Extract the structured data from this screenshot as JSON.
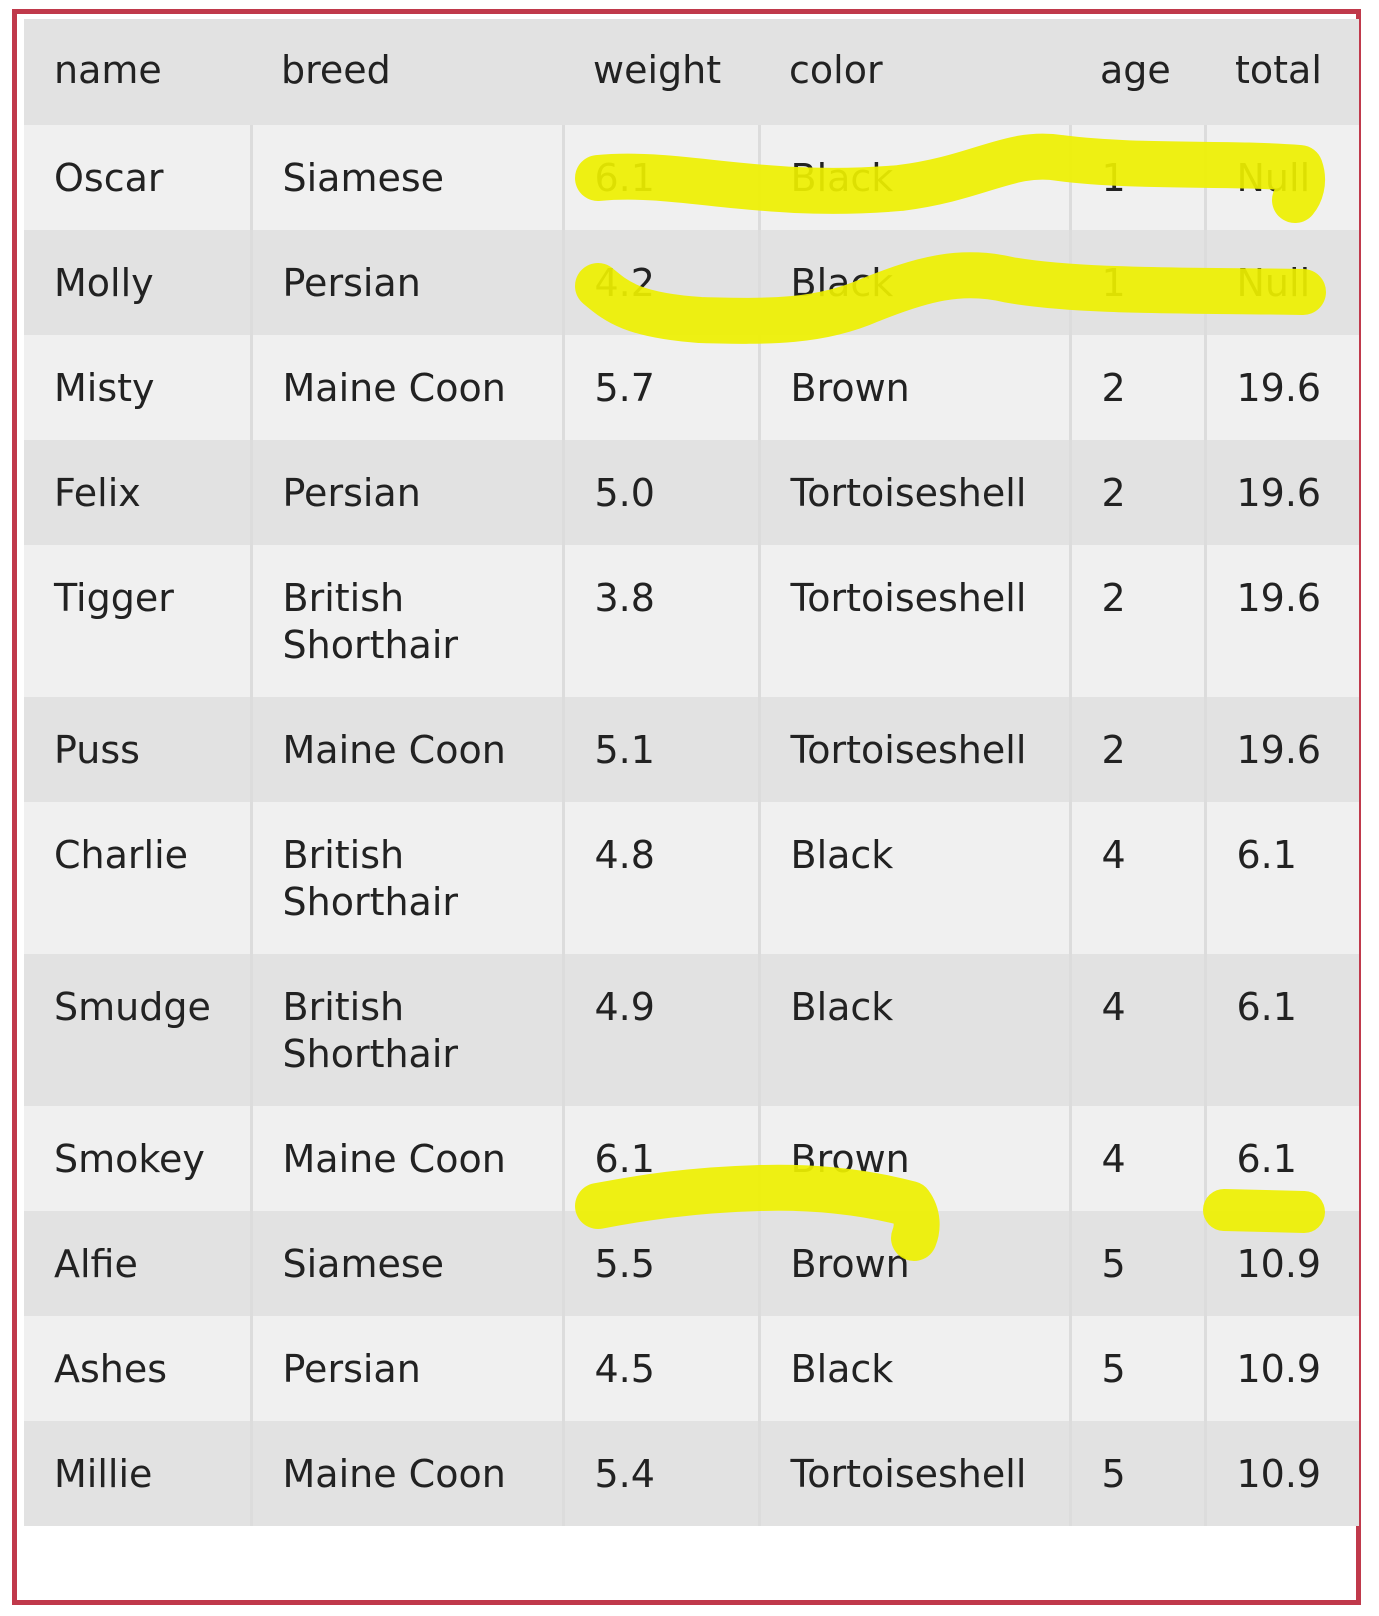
{
  "highlight_color": "#eef000",
  "frame_color": "#c0394b",
  "table": {
    "headers": [
      "name",
      "breed",
      "weight",
      "color",
      "age",
      "total"
    ],
    "rows": [
      [
        "Oscar",
        "Siamese",
        "6.1",
        "Black",
        "1",
        "Null"
      ],
      [
        "Molly",
        "Persian",
        "4.2",
        "Black",
        "1",
        "Null"
      ],
      [
        "Misty",
        "Maine Coon",
        "5.7",
        "Brown",
        "2",
        "19.6"
      ],
      [
        "Felix",
        "Persian",
        "5.0",
        "Tortoiseshell",
        "2",
        "19.6"
      ],
      [
        "Tigger",
        "British Shorthair",
        "3.8",
        "Tortoiseshell",
        "2",
        "19.6"
      ],
      [
        "Puss",
        "Maine Coon",
        "5.1",
        "Tortoiseshell",
        "2",
        "19.6"
      ],
      [
        "Charlie",
        "British Shorthair",
        "4.8",
        "Black",
        "4",
        "6.1"
      ],
      [
        "Smudge",
        "British Shorthair",
        "4.9",
        "Black",
        "4",
        "6.1"
      ],
      [
        "Smokey",
        "Maine Coon",
        "6.1",
        "Brown",
        "4",
        "6.1"
      ],
      [
        "Alfie",
        "Siamese",
        "5.5",
        "Brown",
        "5",
        "10.9"
      ],
      [
        "Ashes",
        "Persian",
        "4.5",
        "Black",
        "5",
        "10.9"
      ],
      [
        "Millie",
        "Maine Coon",
        "5.4",
        "Tortoiseshell",
        "5",
        "10.9"
      ]
    ]
  }
}
